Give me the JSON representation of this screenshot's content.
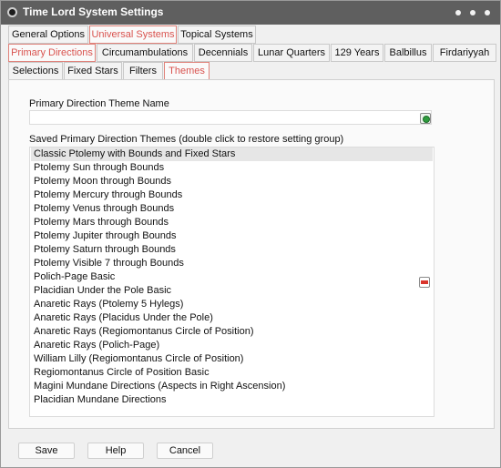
{
  "window": {
    "title": "Time Lord System Settings"
  },
  "tabs_row1": [
    {
      "label": "General Options"
    },
    {
      "label": "Universal Systems"
    },
    {
      "label": "Topical Systems"
    }
  ],
  "tabs_row2": [
    {
      "label": "Primary Directions"
    },
    {
      "label": "Circumambulations"
    },
    {
      "label": "Decennials"
    },
    {
      "label": "Lunar Quarters"
    },
    {
      "label": "129 Years"
    },
    {
      "label": "Balbillus"
    },
    {
      "label": "Firdariyyah"
    }
  ],
  "tabs_row3": [
    {
      "label": "Selections"
    },
    {
      "label": "Fixed Stars"
    },
    {
      "label": "Filters"
    },
    {
      "label": "Themes"
    }
  ],
  "form": {
    "theme_name_label": "Primary Direction Theme Name",
    "theme_name_value": "",
    "saved_label": "Saved Primary Direction Themes (double click to restore setting group)"
  },
  "themes": [
    "Classic Ptolemy with Bounds and Fixed Stars",
    "Ptolemy Sun through Bounds",
    "Ptolemy Moon through Bounds",
    "Ptolemy Mercury through Bounds",
    "Ptolemy Venus through Bounds",
    "Ptolemy Mars through Bounds",
    "Ptolemy Jupiter through Bounds",
    "Ptolemy Saturn through Bounds",
    "Ptolemy Visible 7 through Bounds",
    "Polich-Page Basic",
    "Placidian Under the Pole Basic",
    "Anaretic Rays (Ptolemy 5 Hylegs)",
    "Anaretic Rays (Placidus Under the Pole)",
    "Anaretic Rays (Regiomontanus Circle of Position)",
    "Anaretic Rays (Polich-Page)",
    "William Lilly (Regiomontanus Circle of Position)",
    "Regiomontanus Circle of Position Basic",
    "Magini Mundane Directions (Aspects in Right Ascension)",
    "Placidian Mundane Directions"
  ],
  "buttons": {
    "save": "Save",
    "help": "Help",
    "cancel": "Cancel"
  },
  "icons": {
    "add": "add-theme-icon",
    "delete": "delete-theme-icon"
  },
  "colors": {
    "accent": "#d9534f",
    "titlebar": "#5f5f5f"
  }
}
